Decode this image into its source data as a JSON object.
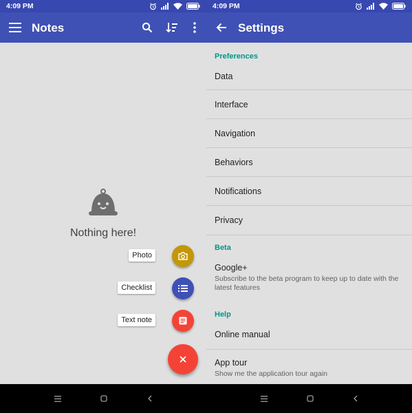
{
  "colors": {
    "primary": "#3f51b5",
    "primary_dark": "#3848b1",
    "accent": "#f44336",
    "teal": "#009688",
    "photo_fab": "#c29808",
    "checklist_fab": "#3f51b5",
    "textnote_fab": "#f44336",
    "background": "#e0e0e0"
  },
  "left": {
    "status": {
      "time": "4:09 PM"
    },
    "appbar": {
      "title": "Notes",
      "icons": [
        "menu-icon",
        "search-icon",
        "sort-icon",
        "more-vert-icon"
      ]
    },
    "empty": {
      "icon": "bell-icon",
      "text": "Nothing here!"
    },
    "fab_menu": [
      {
        "label": "Photo",
        "icon": "camera-icon"
      },
      {
        "label": "Checklist",
        "icon": "list-icon"
      },
      {
        "label": "Text note",
        "icon": "note-icon"
      }
    ],
    "main_fab": {
      "icon": "close-icon"
    }
  },
  "right": {
    "status": {
      "time": "4:09 PM"
    },
    "appbar": {
      "title": "Settings",
      "icons": [
        "back-arrow-icon"
      ]
    },
    "sections": [
      {
        "header": "Preferences",
        "items": [
          "Data",
          "Interface",
          "Navigation",
          "Behaviors",
          "Notifications",
          "Privacy"
        ]
      },
      {
        "header": "Beta",
        "items": [
          {
            "label": "Google+",
            "summary": "Subscribe to the beta program to keep up to date with the latest features"
          }
        ]
      },
      {
        "header": "Help",
        "items": [
          {
            "label": "Online manual"
          },
          {
            "label": "App tour",
            "summary": "Show me the application tour again"
          }
        ]
      }
    ]
  },
  "navbar": {
    "icons": [
      "recents-menu-icon",
      "home-square-icon",
      "back-chevron-icon"
    ]
  }
}
